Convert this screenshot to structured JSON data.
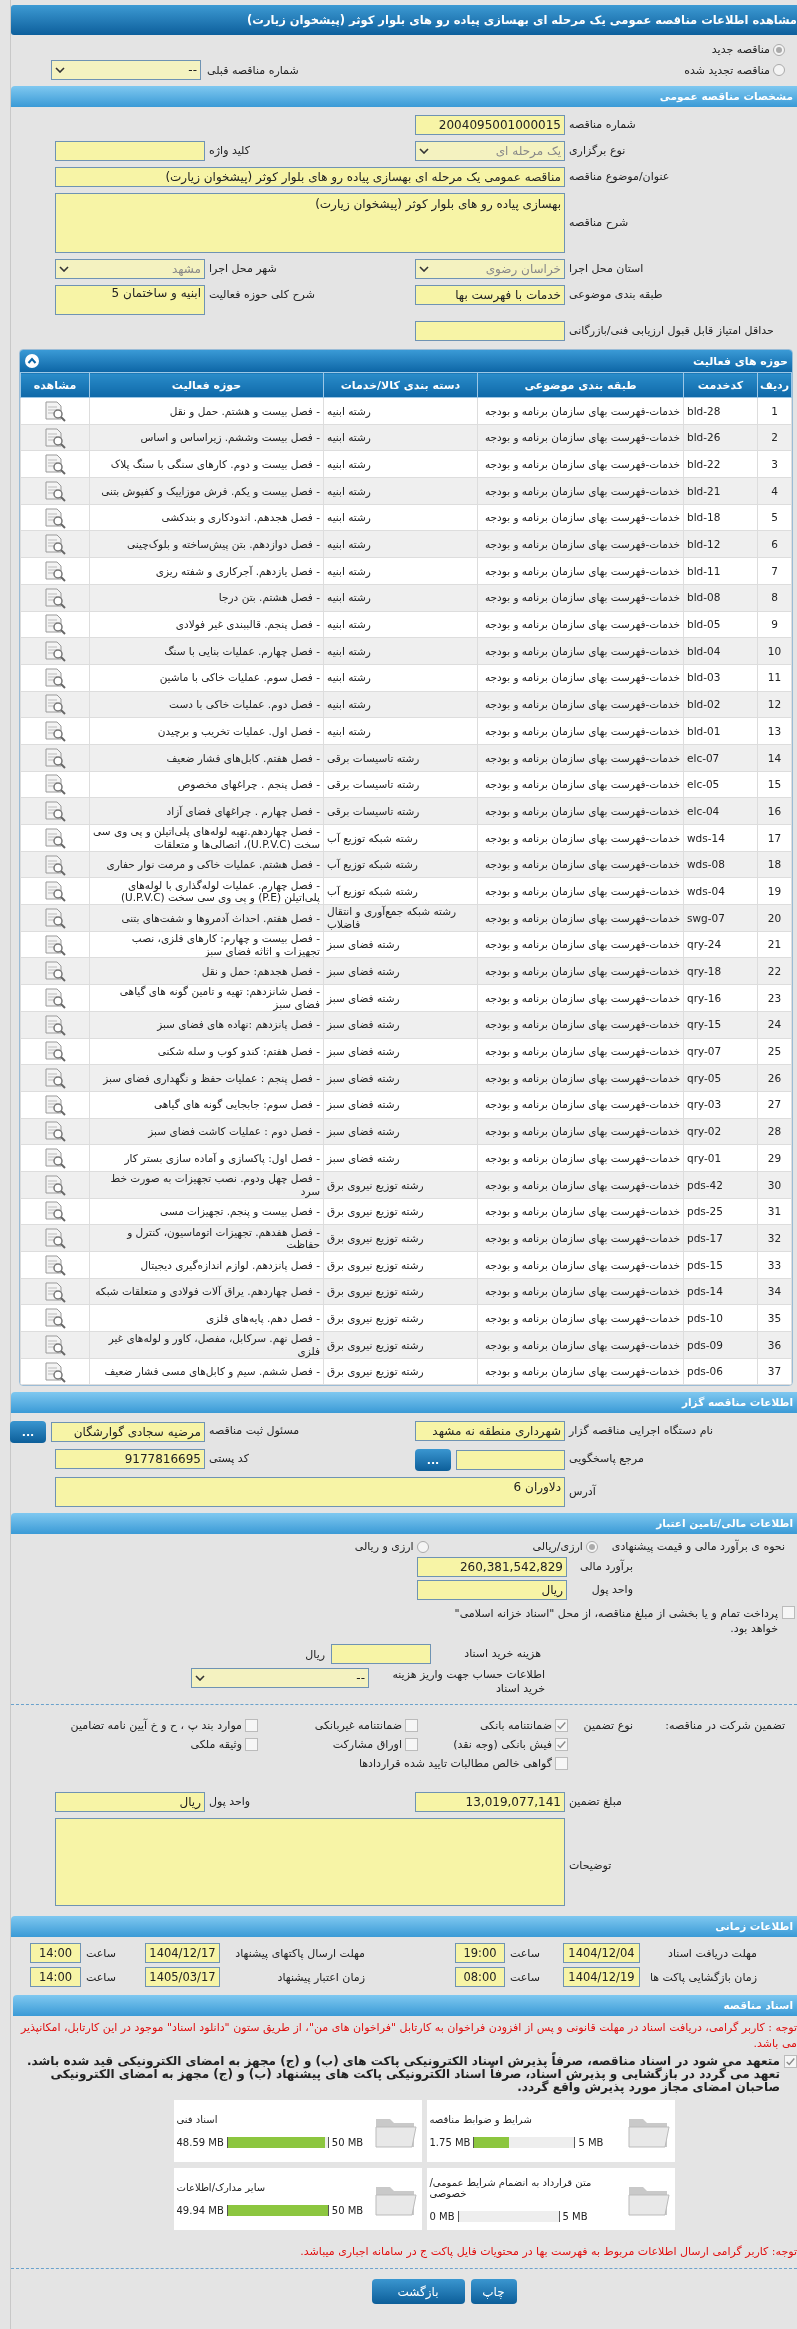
{
  "title": "مشاهده اطلاعات مناقصه عمومی یک مرحله ای بهسازی پیاده رو های بلوار کوثر (پیشخوان زیارت)",
  "tender_type": [
    {
      "label": "مناقصه جدید",
      "selected": true
    },
    {
      "label": "مناقصه تجدید شده",
      "selected": false
    }
  ],
  "previous_tender": {
    "label": "شماره مناقصه قبلی",
    "value": "--"
  },
  "general": {
    "header": "مشخصات مناقصه عمومی",
    "rows": [
      [
        {
          "label": "شماره مناقصه",
          "value": "2004095001000015",
          "kind": "input"
        }
      ],
      [
        {
          "label": "نوع برگزاری",
          "value": "یک مرحله ای",
          "kind": "select",
          "disabled": true
        },
        {
          "label": "کلید واژه",
          "kind": "input"
        }
      ],
      [
        {
          "label": "عنوان/موضوع مناقصه",
          "value": "مناقصه عمومی یک مرحله ای  بهسازی پیاده رو های بلوار کوثر (پیشخوان زیارت)",
          "kind": "wide"
        }
      ],
      [
        {
          "label": "شرح مناقصه",
          "value": "بهسازی پیاده رو های بلوار کوثر (پیشخوان زیارت)",
          "kind": "textarea"
        }
      ],
      [
        {
          "label": "استان محل اجرا",
          "value": "خراسان رضوی",
          "kind": "select",
          "disabled": true
        },
        {
          "label": "شهر محل اجرا",
          "value": "مشهد",
          "kind": "select",
          "disabled": true
        }
      ],
      [
        {
          "label": "طبقه بندی موضوعی",
          "value": "خدمات با فهرست بها",
          "kind": "input"
        },
        {
          "label": "شرح کلی حوزه فعالیت",
          "value": "ابنیه و ساختمان 5",
          "kind": "tall"
        }
      ],
      [
        {
          "label": "حداقل امتیاز قابل قبول ارزیابی فنی/بازرگانی",
          "kind": "input"
        }
      ]
    ]
  },
  "activities": {
    "header": "حوزه های فعالیت",
    "columns": [
      "ردیف",
      "کدخدمت",
      "طبقه بندی موضوعی",
      "دسته بندی کالا/خدمات",
      "حوزه فعالیت",
      "مشاهده"
    ],
    "rows": [
      [
        "1",
        "bld-28",
        "خدمات-فهرست بهای سازمان برنامه و بودجه",
        "رشته ابنیه",
        "- فصل بیست و هشتم. حمل و نقل"
      ],
      [
        "2",
        "bld-26",
        "خدمات-فهرست بهای سازمان برنامه و بودجه",
        "رشته ابنیه",
        "- فصل بیست وششم. زیراساس و اساس"
      ],
      [
        "3",
        "bld-22",
        "خدمات-فهرست بهای سازمان برنامه و بودجه",
        "رشته ابنیه",
        "- فصل بیست و دوم. کارهای سنگی با سنگ پلاک"
      ],
      [
        "4",
        "bld-21",
        "خدمات-فهرست بهای سازمان برنامه و بودجه",
        "رشته ابنیه",
        "- فصل بیست و یکم. فرش موزاییک و کفپوش بتنی"
      ],
      [
        "5",
        "bld-18",
        "خدمات-فهرست بهای سازمان برنامه و بودجه",
        "رشته ابنیه",
        "- فصل هجدهم. اندودکاری و بندکشی"
      ],
      [
        "6",
        "bld-12",
        "خدمات-فهرست بهای سازمان برنامه و بودجه",
        "رشته ابنیه",
        "- فصل دوازدهم. بتن پیش‌ساخته و بلوک‌چینی"
      ],
      [
        "7",
        "bld-11",
        "خدمات-فهرست بهای سازمان برنامه و بودجه",
        "رشته ابنیه",
        "- فصل یازدهم. آجرکاری و شفته ریزی"
      ],
      [
        "8",
        "bld-08",
        "خدمات-فهرست بهای سازمان برنامه و بودجه",
        "رشته ابنیه",
        "- فصل هشتم. بتن درجا"
      ],
      [
        "9",
        "bld-05",
        "خدمات-فهرست بهای سازمان برنامه و بودجه",
        "رشته ابنیه",
        "- فصل پنجم. قالببندی غیر فولادی"
      ],
      [
        "10",
        "bld-04",
        "خدمات-فهرست بهای سازمان برنامه و بودجه",
        "رشته ابنیه",
        "- فصل چهارم. عملیات بنایی با سنگ"
      ],
      [
        "11",
        "bld-03",
        "خدمات-فهرست بهای سازمان برنامه و بودجه",
        "رشته ابنیه",
        "- فصل سوم. عملیات خاکی با ماشین"
      ],
      [
        "12",
        "bld-02",
        "خدمات-فهرست بهای سازمان برنامه و بودجه",
        "رشته ابنیه",
        "- فصل دوم. عملیات خاکی با دست"
      ],
      [
        "13",
        "bld-01",
        "خدمات-فهرست بهای سازمان برنامه و بودجه",
        "رشته ابنیه",
        "- فصل اول. عملیات تخریب و برچیدن"
      ],
      [
        "14",
        "elc-07",
        "خدمات-فهرست بهای سازمان برنامه و بودجه",
        "رشته تاسیسات برقی",
        "- فصل هفتم. کابل‌های فشار ضعیف"
      ],
      [
        "15",
        "elc-05",
        "خدمات-فهرست بهای سازمان برنامه و بودجه",
        "رشته تاسیسات برقی",
        "- فصل پنجم . چراغهای مخصوص"
      ],
      [
        "16",
        "elc-04",
        "خدمات-فهرست بهای سازمان برنامه و بودجه",
        "رشته تاسیسات برقی",
        "- فصل چهارم . چراغهای فضای آزاد"
      ],
      [
        "17",
        "wds-14",
        "خدمات-فهرست بهای سازمان برنامه و بودجه",
        "رشته شبکه توزیع آب",
        "- فصل چهاردهم.تهیه لوله‌های پلی‌اتیلن و پی وی سی سخت (U.P.V.C)، اتصالی‌ها و متعلقات"
      ],
      [
        "18",
        "wds-08",
        "خدمات-فهرست بهای سازمان برنامه و بودجه",
        "رشته شبکه توزیع آب",
        "- فصل هشتم. عملیات خاکی و مرمت نوار حفاری"
      ],
      [
        "19",
        "wds-04",
        "خدمات-فهرست بهای سازمان برنامه و بودجه",
        "رشته شبکه توزیع آب",
        "- فصل چهارم. عملیات لوله‌گذاری با لوله‌های پلی‌اتیلن (P.E) و پی وی سی سخت (U.P.V.C)"
      ],
      [
        "20",
        "swg-07",
        "خدمات-فهرست بهای سازمان برنامه و بودجه",
        "رشته شبکه جمع‌آوری و انتقال فاضلاب",
        "- فصل هفتم. احداث آدمروها و شفت‌های بتنی"
      ],
      [
        "21",
        "qry-24",
        "خدمات-فهرست بهای سازمان برنامه و بودجه",
        "رشته فضای سبز",
        "- فصل بیست و چهارم: کارهای فلزی، نصب تجهیزات و اثاثه فضای سبز"
      ],
      [
        "22",
        "qry-18",
        "خدمات-فهرست بهای سازمان برنامه و بودجه",
        "رشته فضای سبز",
        "- فصل هجدهم: حمل و نقل"
      ],
      [
        "23",
        "qry-16",
        "خدمات-فهرست بهای سازمان برنامه و بودجه",
        "رشته فضای سبز",
        "- فصل شانزدهم: تهیه و تامین گونه های گیاهی فضای سبز"
      ],
      [
        "24",
        "qry-15",
        "خدمات-فهرست بهای سازمان برنامه و بودجه",
        "رشته فضای سبز",
        "- فصل پانزدهم :نهاده های فضای سبز"
      ],
      [
        "25",
        "qry-07",
        "خدمات-فهرست بهای سازمان برنامه و بودجه",
        "رشته فضای سبز",
        "- فصل هفتم: کندو کوب و سله شکنی"
      ],
      [
        "26",
        "qry-05",
        "خدمات-فهرست بهای سازمان برنامه و بودجه",
        "رشته فضای سبز",
        "- فصل پنجم : عملیات حفظ و نگهداری فضای سبز"
      ],
      [
        "27",
        "qry-03",
        "خدمات-فهرست بهای سازمان برنامه و بودجه",
        "رشته فضای سبز",
        "- فصل سوم: جابجایی گونه های گیاهی"
      ],
      [
        "28",
        "qry-02",
        "خدمات-فهرست بهای سازمان برنامه و بودجه",
        "رشته فضای سبز",
        "- فصل دوم : عملیات کاشت فضای سبز"
      ],
      [
        "29",
        "qry-01",
        "خدمات-فهرست بهای سازمان برنامه و بودجه",
        "رشته فضای سبز",
        "- فصل اول:  پاکسازی و آماده سازی بستر کار"
      ],
      [
        "30",
        "pds-42",
        "خدمات-فهرست بهای سازمان برنامه و بودجه",
        "رشته توزیع نیروی برق",
        "- فصل چهل ودوم. نصب تجهیزات به صورت خط سرد"
      ],
      [
        "31",
        "pds-25",
        "خدمات-فهرست بهای سازمان برنامه و بودجه",
        "رشته توزیع نیروی برق",
        "- فصل بیست و پنجم. تجهیزات مسی"
      ],
      [
        "32",
        "pds-17",
        "خدمات-فهرست بهای سازمان برنامه و بودجه",
        "رشته توزیع نیروی برق",
        "- فصل هفدهم. تجهیزات اتوماسیون، کنترل و حفاظت"
      ],
      [
        "33",
        "pds-15",
        "خدمات-فهرست بهای سازمان برنامه و بودجه",
        "رشته توزیع نیروی برق",
        "- فصل پانزدهم. لوازم اندازه‌گیری دیجیتال"
      ],
      [
        "34",
        "pds-14",
        "خدمات-فهرست بهای سازمان برنامه و بودجه",
        "رشته توزیع نیروی برق",
        "- فصل چهاردهم. یراق آلات فولادی و متعلقات شبکه"
      ],
      [
        "35",
        "pds-10",
        "خدمات-فهرست بهای سازمان برنامه و بودجه",
        "رشته توزیع نیروی برق",
        "- فصل دهم. پایه‌های فلزی"
      ],
      [
        "36",
        "pds-09",
        "خدمات-فهرست بهای سازمان برنامه و بودجه",
        "رشته توزیع نیروی برق",
        "- فصل نهم. سرکابل، مفصل، کاور و لوله‌های غیر فلزی"
      ],
      [
        "37",
        "pds-06",
        "خدمات-فهرست بهای سازمان برنامه و بودجه",
        "رشته توزیع نیروی برق",
        "- فصل ششم. سیم و کابل‌های مسی فشار ضعیف"
      ]
    ]
  },
  "tenderer": {
    "header": "اطلاعات مناقصه گزار",
    "rows": [
      [
        {
          "label": "نام دستگاه اجرایی مناقصه گزار",
          "value": "شهرداری منطقه نه مشهد",
          "kind": "input"
        },
        {
          "label": "مسئول ثبت مناقصه",
          "value": "مرضیه سجادی گوارشگان",
          "kind": "input",
          "button": "..."
        }
      ],
      [
        {
          "label": "مرجع پاسخگویی",
          "kind": "input",
          "button": "..."
        },
        {
          "label": "کد پستی",
          "value": "9177816695",
          "kind": "input"
        }
      ],
      [
        {
          "label": "آدرس",
          "value": "دلاوران 6",
          "kind": "address"
        }
      ]
    ]
  },
  "finance": {
    "header": "اطلاعات مالی/تامین اعتبار",
    "method": {
      "label": "نحوه ی برآورد مالی و قیمت پیشنهادی",
      "options": [
        {
          "label": "ارزی/ریالی",
          "selected": true
        },
        {
          "label": "ارزی و ریالی",
          "selected": false
        }
      ]
    },
    "budget": {
      "label": "برآورد مالی",
      "value": "260,381,542,829"
    },
    "currency": {
      "label": "واحد پول",
      "value": "ریال"
    },
    "treasury": {
      "label": "پرداخت تمام و یا بخشی از مبلغ مناقصه، از محل \"اسناد خزانه اسلامی\" خواهد بود.",
      "checked": false
    },
    "doc_fee": {
      "label": "هزینه خرید اسناد",
      "unit": "ریال"
    },
    "account": {
      "label": "اطلاعات حساب جهت واریز هزینه خرید اسناد",
      "value": "--"
    }
  },
  "guarantee": {
    "label": "تضمین شرکت در مناقصه:",
    "type_label": "نوع تضمین",
    "options": [
      {
        "label": "ضمانتنامه بانکی",
        "checked": true
      },
      {
        "label": "ضمانتنامه غیربانکی",
        "checked": false
      },
      {
        "label": "موارد بند پ ، ح و خ آیین نامه تضامین",
        "checked": false
      },
      {
        "label": "فیش بانکی (وجه نقد)",
        "checked": true
      },
      {
        "label": "اوراق مشارکت",
        "checked": false
      },
      {
        "label": "وثیقه ملکی",
        "checked": false
      },
      {
        "label": "گواهی خالص مطالبات تایید شده قراردادها",
        "checked": false
      }
    ],
    "amount": {
      "label": "مبلغ تضمین",
      "value": "13,019,077,141"
    },
    "currency": {
      "label": "واحد پول",
      "value": "ریال"
    },
    "notes": {
      "label": "توضیحات"
    }
  },
  "timing": {
    "header": "اطلاعات زمانی",
    "items": [
      {
        "label": "مهلت دریافت اسناد",
        "date": "1404/12/04",
        "time_label": "ساعت",
        "time": "19:00"
      },
      {
        "label": "مهلت ارسال پاکتهای پیشنهاد",
        "date": "1404/12/17",
        "time_label": "ساعت",
        "time": "14:00"
      },
      {
        "label": "زمان بازگشایی پاکت ها",
        "date": "1404/12/19",
        "time_label": "ساعت",
        "time": "08:00"
      },
      {
        "label": "زمان اعتبار پیشنهاد",
        "date": "1405/03/17",
        "time_label": "ساعت",
        "time": "14:00"
      }
    ]
  },
  "documents": {
    "header": "اسناد مناقصه",
    "notice": "توجه : کاربر گرامی، دریافت اسناد در مهلت قانونی و پس از افزودن فراخوان به کارتابل \"فراخوان های من\"، از طریق ستون \"دانلود اسناد\" موجود در این کارتابل، امکانپذیر می باشد.",
    "commitment": {
      "text": "متعهد می شود در اسناد مناقصه، صرفاً پذیرش اسناد الکترونیکی پاکت های (ب) و (ج) مجهز به امضای الکترونیکی قید شده باشد. تعهد می گردد در بازگشایی و پذیرش اسناد، صرفاً اسناد الکترونیکی پاکت های پیشنهاد (ب) و (ج) مجهز به امضای الکترونیکی صاحبان امضای مجاز مورد پذیرش واقع گردد.",
      "checked": true
    },
    "files": [
      {
        "name": "شرایط و ضوابط مناقصه",
        "size": "1.75 MB",
        "max": "5 MB",
        "level": 0.35
      },
      {
        "name": "اسناد فنی",
        "size": "48.59 MB",
        "max": "50 MB",
        "level": 0.97
      },
      {
        "name": "متن قرارداد به انضمام شرایط عمومی/خصوصی",
        "size": "0 MB",
        "max": "5 MB",
        "level": 0
      },
      {
        "name": "سایر مدارک/اطلاعات",
        "size": "49.94 MB",
        "max": "50 MB",
        "level": 1
      }
    ],
    "note": "توجه: کاربر گرامی ارسال اطلاعات مربوط به فهرست بها در محتویات فایل پاکت ج در سامانه اجباری میباشد."
  },
  "buttons": [
    "چاپ",
    "بازگشت"
  ]
}
